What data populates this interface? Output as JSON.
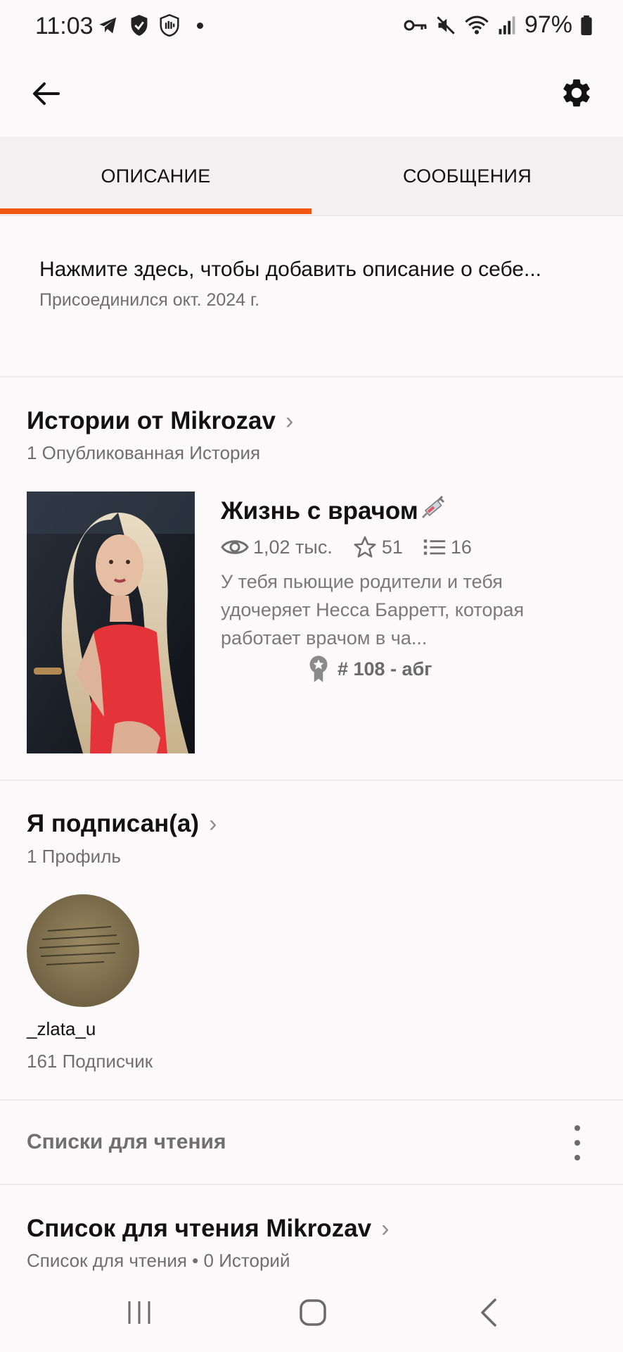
{
  "status_bar": {
    "time": "11:03",
    "battery": "97%"
  },
  "tabs": [
    {
      "label": "ОПИСАНИЕ"
    },
    {
      "label": "СООБЩЕНИЯ"
    }
  ],
  "about": {
    "description_prompt": "Нажмите здесь, чтобы добавить описание о себе...",
    "joined": "Присоединился окт. 2024 г."
  },
  "stories": {
    "title": "Истории от Mikrozav",
    "subtitle": "1 Опубликованная История",
    "items": [
      {
        "title": "Жизнь с врачом",
        "views": "1,02 тыс.",
        "votes": "51",
        "parts": "16",
        "description": "У тебя пьющие родители и тебя удочеряет Несса Барретт, которая работает врачом в ча...",
        "rank": "# 108 - абг"
      }
    ]
  },
  "following": {
    "title": "Я подписан(а)",
    "subtitle": "1 Профиль",
    "profiles": [
      {
        "username": "_zlata_u",
        "followers": "161 Подписчик"
      }
    ]
  },
  "reading_lists": {
    "header": "Списки для чтения",
    "list_title": "Список для чтения Mikrozav",
    "list_subtitle": "Список для чтения • 0 Историй"
  },
  "colors": {
    "accent": "#f0560f",
    "background": "#fbf9f9"
  }
}
